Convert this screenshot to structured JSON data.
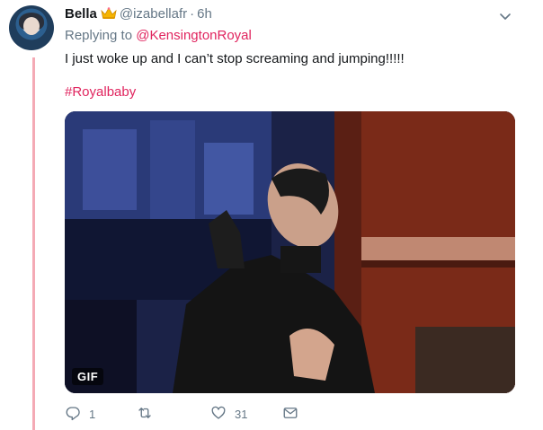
{
  "tweet": {
    "name": "Bella",
    "handle": "@izabellafr",
    "dot": "·",
    "time": "6h",
    "replying_prefix": "Replying to",
    "replying_to": "@KensingtonRoyal",
    "text": "I just woke up and I can’t stop screaming and jumping!!!!!",
    "hashtag": "#Royalbaby",
    "media_badge": "GIF"
  },
  "actions": {
    "reply_count": "1",
    "retweet_count": "",
    "like_count": "31"
  },
  "icons": [
    "crown-icon",
    "chevron-down-icon",
    "reply-icon",
    "retweet-icon",
    "like-icon",
    "message-icon"
  ],
  "colors": {
    "accent": "#e0245e",
    "thread_line": "#f4aab5",
    "secondary_text": "#657786"
  }
}
